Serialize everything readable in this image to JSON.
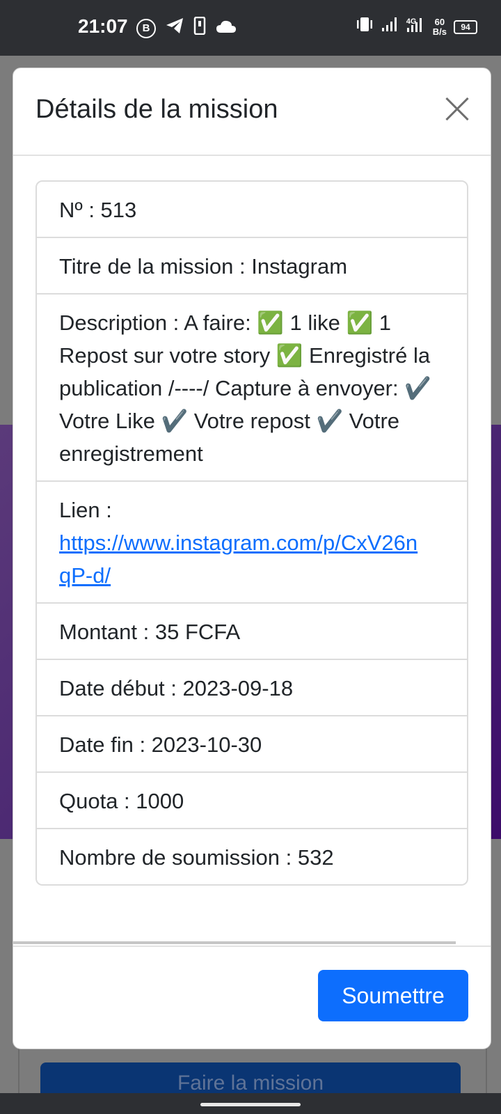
{
  "status_bar": {
    "time": "21:07",
    "left_icons": [
      "b-circle-icon",
      "telegram-icon",
      "phone-icon",
      "cloud-icon"
    ],
    "network": "4G",
    "speed_value": "60",
    "speed_unit": "B/s",
    "battery": "94"
  },
  "modal": {
    "title": "Détails de la mission",
    "items": [
      "Nº : 513",
      "Titre de la mission : Instagram",
      "Description : A faire: ✅ 1 like ✅ 1 Repost sur votre story ✅ Enregistré la publication /----/ Capture à envoyer: ✔️ Votre Like ✔️ Votre repost ✔️ Votre enregistrement",
      "Montant : 35 FCFA",
      "Date début : 2023-09-18",
      "Date fin : 2023-10-30",
      "Quota : 1000",
      "Nombre de soumission : 532"
    ],
    "link_label": "Lien :",
    "link_url_line1": "https://www.instagram.com/p/CxV26n",
    "link_url_line2": "qP-d/",
    "submit_label": "Soumettre"
  },
  "background": {
    "button_label": "Faire la mission"
  },
  "colors": {
    "primary": "#0d6efd",
    "status_bar": "#2d2f33",
    "overlay": "#7c7c7c",
    "purple": "#4b2872"
  }
}
